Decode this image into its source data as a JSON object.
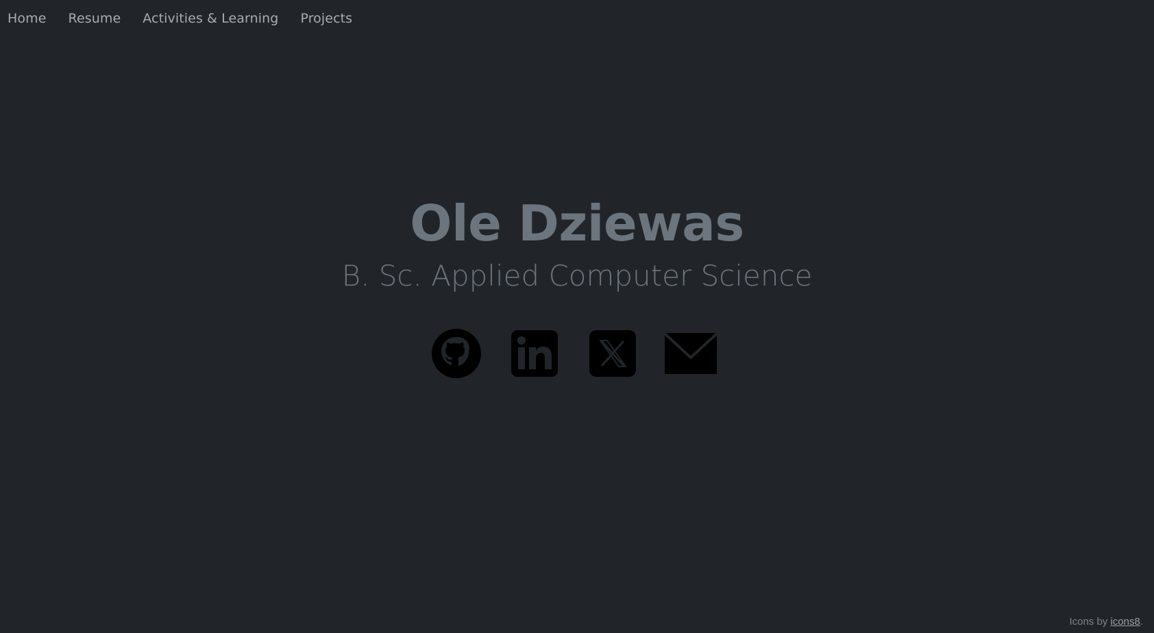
{
  "nav": {
    "items": [
      {
        "label": "Home"
      },
      {
        "label": "Resume"
      },
      {
        "label": "Activities & Learning"
      },
      {
        "label": "Projects"
      }
    ]
  },
  "hero": {
    "name": "Ole Dziewas",
    "subtitle": "B. Sc. Applied Computer Science"
  },
  "socials": [
    {
      "icon": "github-icon"
    },
    {
      "icon": "linkedin-icon"
    },
    {
      "icon": "x-icon"
    },
    {
      "icon": "mail-icon"
    }
  ],
  "footer": {
    "prefix": "Icons by ",
    "link_label": "icons8",
    "suffix": "."
  },
  "colors": {
    "background": "#212529",
    "text_muted": "#6c757d",
    "nav_text": "#a8adb3",
    "icon_fill": "#000000"
  }
}
